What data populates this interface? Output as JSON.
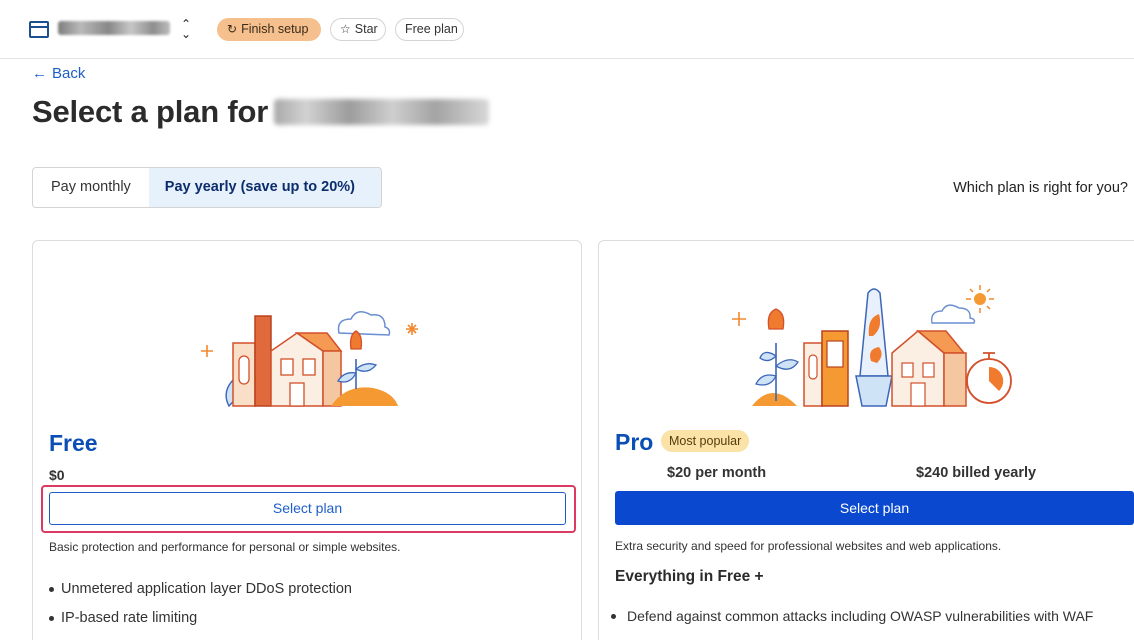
{
  "header": {
    "setup_label": "Finish setup",
    "star_label": "Star",
    "plan_label": "Free plan"
  },
  "back_label": "Back",
  "title": "Select a plan for",
  "billing": {
    "monthly_label": "Pay monthly",
    "yearly_label": "Pay yearly (save up to 20%)",
    "selected": "yearly"
  },
  "help_link": "Which plan is right for you?",
  "plans": {
    "free": {
      "name": "Free",
      "price": "$0",
      "button_label": "Select plan",
      "description": "Basic protection and performance for personal or simple websites.",
      "features": [
        "Unmetered application layer DDoS protection",
        "IP-based rate limiting"
      ]
    },
    "pro": {
      "name": "Pro",
      "badge": "Most popular",
      "price_month": "$20 per month",
      "price_year": "$240 billed yearly",
      "button_label": "Select plan",
      "description": "Extra security and speed for professional websites and web applications.",
      "includes_heading": "Everything in Free +",
      "features": [
        "Defend against common attacks including OWASP vulnerabilities with WAF"
      ]
    }
  },
  "colors": {
    "accent": "#0a49cf",
    "link": "#1f5ec9",
    "setup_pill": "#f6c08e",
    "highlight": "#dc3a63",
    "badge": "#fbe3a7"
  }
}
